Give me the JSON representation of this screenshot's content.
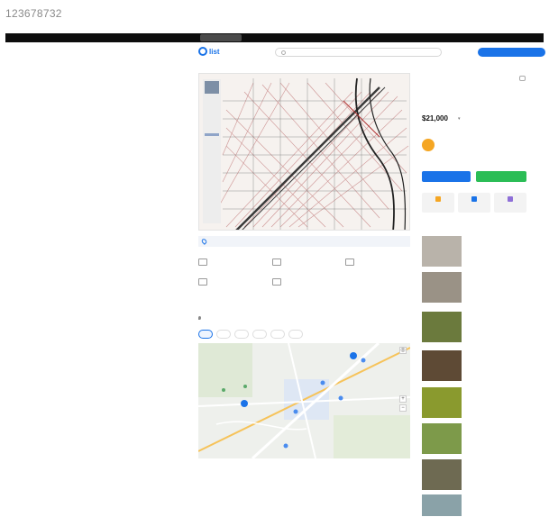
{
  "page_id": "123678732",
  "topbar": {
    "nav": [
      "",
      "",
      ""
    ],
    "right": [
      "",
      ""
    ]
  },
  "header": {
    "logo": "list",
    "categories": "",
    "search_placeholder": "",
    "login": "",
    "post_button": ""
  },
  "breadcrumbs": "",
  "listing_number": "",
  "photo": {
    "view_on_map": ""
  },
  "features": [
    {
      "label": "",
      "sub": "",
      "icon": "area-icon"
    },
    {
      "label": "",
      "sub": "",
      "icon": "plot-icon"
    },
    {
      "label": "",
      "sub": "",
      "icon": "land-icon"
    },
    {
      "label": "",
      "sub": "",
      "icon": "doc-icon"
    },
    {
      "label": "",
      "sub": "",
      "icon": "road-icon"
    }
  ],
  "location": {
    "title": "",
    "address": "",
    "chips": [
      "",
      "",
      "",
      "",
      "",
      ""
    ]
  },
  "description": {
    "title": "",
    "text": ""
  },
  "listing": {
    "title": "",
    "price": "$21,000",
    "price_toggle": "▾",
    "seller_name": "",
    "seller_sub": "",
    "date": ""
  },
  "contact": {
    "call": "",
    "message": ""
  },
  "actions": [
    {
      "label": "",
      "color": "#f5a623"
    },
    {
      "label": "",
      "color": "#1a73e8"
    },
    {
      "label": "",
      "color": "#8e6fd8"
    }
  ],
  "similar": {
    "title": "",
    "items": [
      {
        "title": "",
        "price": "",
        "color": "#b9b3aa"
      },
      {
        "title": "",
        "price": "",
        "color": "#9a9286"
      },
      {
        "title": "",
        "price": "",
        "color": "#6b7a3d"
      },
      {
        "title": "",
        "price": "",
        "color": "#5e4a35"
      },
      {
        "title": "",
        "price": "",
        "color": "#8a9a2e"
      },
      {
        "title": "",
        "price": "",
        "color": "#7d9a4a"
      },
      {
        "title": "",
        "price": "",
        "color": "#6e6a52"
      },
      {
        "title": "",
        "price": "",
        "color": "#8aa2a8"
      }
    ]
  },
  "colors": {
    "accent": "#1a73e8",
    "green": "#2bbd56",
    "topbar": "#0d0d0d"
  }
}
